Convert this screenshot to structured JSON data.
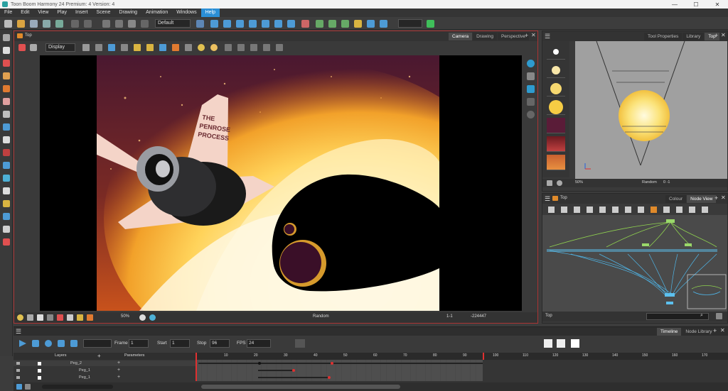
{
  "window": {
    "title": "Toon Boom Harmony 24 Premium: 4 Version: 4",
    "minimize": "—",
    "maximize": "☐",
    "close": "✕"
  },
  "menu": [
    "File",
    "Edit",
    "View",
    "Play",
    "Insert",
    "Scene",
    "Drawing",
    "Animation",
    "Windows",
    "Help"
  ],
  "menu_active": "Help",
  "toolbar": {
    "preset": "Default"
  },
  "camera_view": {
    "breadcrumb": "Top",
    "display_select": "Display",
    "tabs": [
      "Camera",
      "Drawing",
      "Perspective"
    ],
    "active_tab": "Camera",
    "status_zoom": "50%",
    "status_mode": "Random",
    "status_frame": "1-1",
    "status_coords": "-224447"
  },
  "artwork": {
    "ship_text_1": "THE",
    "ship_text_2": "PENROSE",
    "ship_text_3": "PROCESS"
  },
  "right_panel": {
    "tabs": [
      "Tool Properties",
      "Library",
      "Top"
    ],
    "active_tab": "Top",
    "zoom": "50%",
    "status": "Random",
    "frame": "0 -1"
  },
  "node_view": {
    "breadcrumb": "Top",
    "tabs": [
      "Colour",
      "Node View"
    ],
    "active_tab": "Node View",
    "search_label": "Top"
  },
  "timeline": {
    "tabs": [
      "Timeline",
      "Node Library"
    ],
    "active_tab": "Timeline",
    "frame_label": "Frame",
    "frame_value": "1",
    "start_label": "Start",
    "start_value": "1",
    "stop_label": "Stop",
    "stop_value": "96",
    "fps_label": "FPS",
    "fps_value": "24",
    "layers_header": "Layers",
    "params_header": "Parameters",
    "layers": [
      {
        "name": "Peg_2"
      },
      {
        "name": "Peg_1"
      },
      {
        "name": "Peg_1"
      }
    ],
    "ruler": [
      "10",
      "20",
      "30",
      "40",
      "50",
      "60",
      "70",
      "80",
      "90",
      "100",
      "110",
      "120",
      "130",
      "140",
      "150",
      "160",
      "170"
    ]
  }
}
